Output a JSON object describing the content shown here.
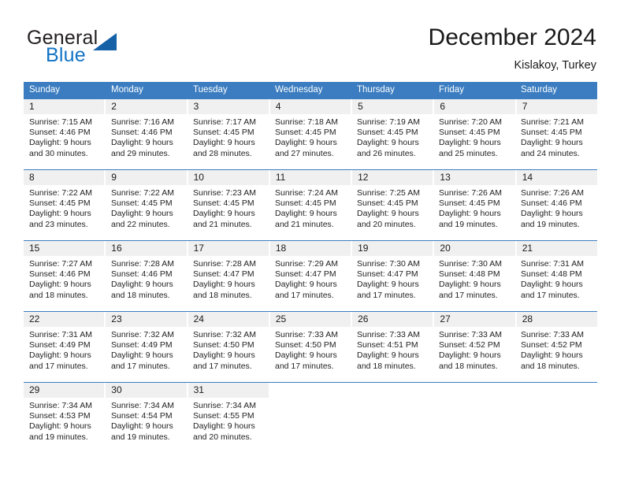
{
  "brand": {
    "name_top": "General",
    "name_bottom": "Blue",
    "color_dark": "#231f20",
    "color_blue": "#1273c4",
    "triangle_color": "#1461a8"
  },
  "header": {
    "title": "December 2024",
    "subtitle": "Kislakoy, Turkey"
  },
  "theme": {
    "header_blue": "#3b7dc0",
    "daynum_gray": "#f0f0f0",
    "text": "#222222"
  },
  "weekdays": [
    "Sunday",
    "Monday",
    "Tuesday",
    "Wednesday",
    "Thursday",
    "Friday",
    "Saturday"
  ],
  "weeks": [
    [
      {
        "day": "1",
        "sunrise": "Sunrise: 7:15 AM",
        "sunset": "Sunset: 4:46 PM",
        "daylight1": "Daylight: 9 hours",
        "daylight2": "and 30 minutes."
      },
      {
        "day": "2",
        "sunrise": "Sunrise: 7:16 AM",
        "sunset": "Sunset: 4:46 PM",
        "daylight1": "Daylight: 9 hours",
        "daylight2": "and 29 minutes."
      },
      {
        "day": "3",
        "sunrise": "Sunrise: 7:17 AM",
        "sunset": "Sunset: 4:45 PM",
        "daylight1": "Daylight: 9 hours",
        "daylight2": "and 28 minutes."
      },
      {
        "day": "4",
        "sunrise": "Sunrise: 7:18 AM",
        "sunset": "Sunset: 4:45 PM",
        "daylight1": "Daylight: 9 hours",
        "daylight2": "and 27 minutes."
      },
      {
        "day": "5",
        "sunrise": "Sunrise: 7:19 AM",
        "sunset": "Sunset: 4:45 PM",
        "daylight1": "Daylight: 9 hours",
        "daylight2": "and 26 minutes."
      },
      {
        "day": "6",
        "sunrise": "Sunrise: 7:20 AM",
        "sunset": "Sunset: 4:45 PM",
        "daylight1": "Daylight: 9 hours",
        "daylight2": "and 25 minutes."
      },
      {
        "day": "7",
        "sunrise": "Sunrise: 7:21 AM",
        "sunset": "Sunset: 4:45 PM",
        "daylight1": "Daylight: 9 hours",
        "daylight2": "and 24 minutes."
      }
    ],
    [
      {
        "day": "8",
        "sunrise": "Sunrise: 7:22 AM",
        "sunset": "Sunset: 4:45 PM",
        "daylight1": "Daylight: 9 hours",
        "daylight2": "and 23 minutes."
      },
      {
        "day": "9",
        "sunrise": "Sunrise: 7:22 AM",
        "sunset": "Sunset: 4:45 PM",
        "daylight1": "Daylight: 9 hours",
        "daylight2": "and 22 minutes."
      },
      {
        "day": "10",
        "sunrise": "Sunrise: 7:23 AM",
        "sunset": "Sunset: 4:45 PM",
        "daylight1": "Daylight: 9 hours",
        "daylight2": "and 21 minutes."
      },
      {
        "day": "11",
        "sunrise": "Sunrise: 7:24 AM",
        "sunset": "Sunset: 4:45 PM",
        "daylight1": "Daylight: 9 hours",
        "daylight2": "and 21 minutes."
      },
      {
        "day": "12",
        "sunrise": "Sunrise: 7:25 AM",
        "sunset": "Sunset: 4:45 PM",
        "daylight1": "Daylight: 9 hours",
        "daylight2": "and 20 minutes."
      },
      {
        "day": "13",
        "sunrise": "Sunrise: 7:26 AM",
        "sunset": "Sunset: 4:45 PM",
        "daylight1": "Daylight: 9 hours",
        "daylight2": "and 19 minutes."
      },
      {
        "day": "14",
        "sunrise": "Sunrise: 7:26 AM",
        "sunset": "Sunset: 4:46 PM",
        "daylight1": "Daylight: 9 hours",
        "daylight2": "and 19 minutes."
      }
    ],
    [
      {
        "day": "15",
        "sunrise": "Sunrise: 7:27 AM",
        "sunset": "Sunset: 4:46 PM",
        "daylight1": "Daylight: 9 hours",
        "daylight2": "and 18 minutes."
      },
      {
        "day": "16",
        "sunrise": "Sunrise: 7:28 AM",
        "sunset": "Sunset: 4:46 PM",
        "daylight1": "Daylight: 9 hours",
        "daylight2": "and 18 minutes."
      },
      {
        "day": "17",
        "sunrise": "Sunrise: 7:28 AM",
        "sunset": "Sunset: 4:47 PM",
        "daylight1": "Daylight: 9 hours",
        "daylight2": "and 18 minutes."
      },
      {
        "day": "18",
        "sunrise": "Sunrise: 7:29 AM",
        "sunset": "Sunset: 4:47 PM",
        "daylight1": "Daylight: 9 hours",
        "daylight2": "and 17 minutes."
      },
      {
        "day": "19",
        "sunrise": "Sunrise: 7:30 AM",
        "sunset": "Sunset: 4:47 PM",
        "daylight1": "Daylight: 9 hours",
        "daylight2": "and 17 minutes."
      },
      {
        "day": "20",
        "sunrise": "Sunrise: 7:30 AM",
        "sunset": "Sunset: 4:48 PM",
        "daylight1": "Daylight: 9 hours",
        "daylight2": "and 17 minutes."
      },
      {
        "day": "21",
        "sunrise": "Sunrise: 7:31 AM",
        "sunset": "Sunset: 4:48 PM",
        "daylight1": "Daylight: 9 hours",
        "daylight2": "and 17 minutes."
      }
    ],
    [
      {
        "day": "22",
        "sunrise": "Sunrise: 7:31 AM",
        "sunset": "Sunset: 4:49 PM",
        "daylight1": "Daylight: 9 hours",
        "daylight2": "and 17 minutes."
      },
      {
        "day": "23",
        "sunrise": "Sunrise: 7:32 AM",
        "sunset": "Sunset: 4:49 PM",
        "daylight1": "Daylight: 9 hours",
        "daylight2": "and 17 minutes."
      },
      {
        "day": "24",
        "sunrise": "Sunrise: 7:32 AM",
        "sunset": "Sunset: 4:50 PM",
        "daylight1": "Daylight: 9 hours",
        "daylight2": "and 17 minutes."
      },
      {
        "day": "25",
        "sunrise": "Sunrise: 7:33 AM",
        "sunset": "Sunset: 4:50 PM",
        "daylight1": "Daylight: 9 hours",
        "daylight2": "and 17 minutes."
      },
      {
        "day": "26",
        "sunrise": "Sunrise: 7:33 AM",
        "sunset": "Sunset: 4:51 PM",
        "daylight1": "Daylight: 9 hours",
        "daylight2": "and 18 minutes."
      },
      {
        "day": "27",
        "sunrise": "Sunrise: 7:33 AM",
        "sunset": "Sunset: 4:52 PM",
        "daylight1": "Daylight: 9 hours",
        "daylight2": "and 18 minutes."
      },
      {
        "day": "28",
        "sunrise": "Sunrise: 7:33 AM",
        "sunset": "Sunset: 4:52 PM",
        "daylight1": "Daylight: 9 hours",
        "daylight2": "and 18 minutes."
      }
    ],
    [
      {
        "day": "29",
        "sunrise": "Sunrise: 7:34 AM",
        "sunset": "Sunset: 4:53 PM",
        "daylight1": "Daylight: 9 hours",
        "daylight2": "and 19 minutes."
      },
      {
        "day": "30",
        "sunrise": "Sunrise: 7:34 AM",
        "sunset": "Sunset: 4:54 PM",
        "daylight1": "Daylight: 9 hours",
        "daylight2": "and 19 minutes."
      },
      {
        "day": "31",
        "sunrise": "Sunrise: 7:34 AM",
        "sunset": "Sunset: 4:55 PM",
        "daylight1": "Daylight: 9 hours",
        "daylight2": "and 20 minutes."
      },
      {
        "day": "",
        "sunrise": "",
        "sunset": "",
        "daylight1": "",
        "daylight2": ""
      },
      {
        "day": "",
        "sunrise": "",
        "sunset": "",
        "daylight1": "",
        "daylight2": ""
      },
      {
        "day": "",
        "sunrise": "",
        "sunset": "",
        "daylight1": "",
        "daylight2": ""
      },
      {
        "day": "",
        "sunrise": "",
        "sunset": "",
        "daylight1": "",
        "daylight2": ""
      }
    ]
  ]
}
